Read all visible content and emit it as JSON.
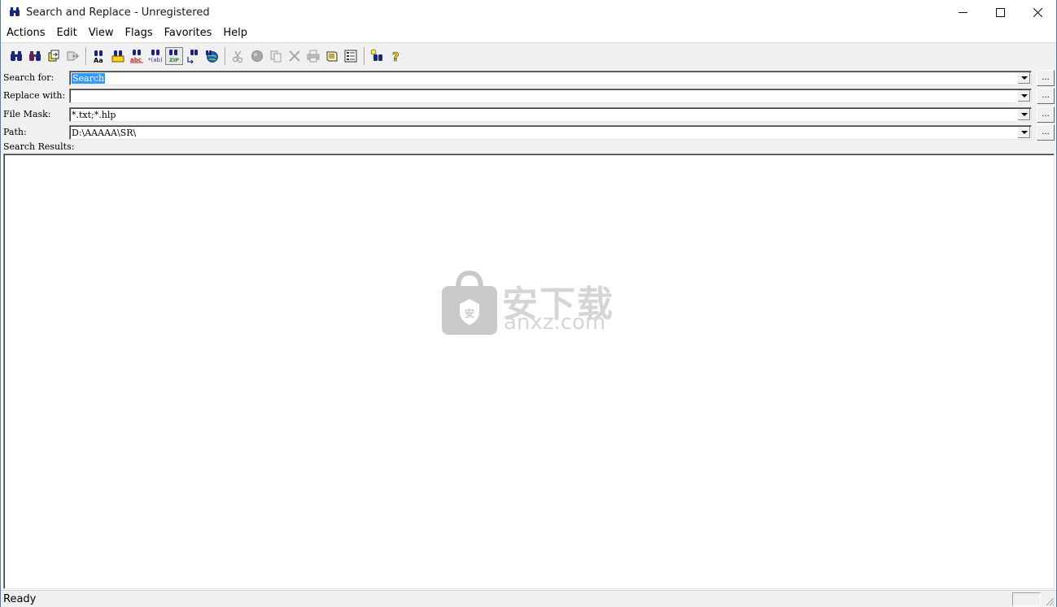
{
  "window": {
    "title": "Search and Replace - Unregistered",
    "controls": {
      "minimize": "—",
      "maximize": "☐",
      "close": "✕"
    }
  },
  "menu": {
    "items": [
      "Actions",
      "Edit",
      "View",
      "Flags",
      "Favorites",
      "Help"
    ]
  },
  "toolbar": {
    "groups": [
      [
        "search-icon",
        "search-replace-icon",
        "copy-files-icon",
        "move-files-icon"
      ],
      [
        "case-sensitive-icon",
        "whole-word-icon",
        "abc-icon",
        "regex-icon",
        "zip-search-icon",
        "subfolder-icon",
        "web-search-icon"
      ],
      [
        "scissors-icon",
        "stop-icon",
        "copy-icon",
        "delete-icon",
        "print-icon",
        "open-script-icon",
        "options-icon"
      ],
      [
        "find-tip-icon",
        "help-icon"
      ]
    ]
  },
  "form": {
    "search_label": "Search for:",
    "search_value": "Search",
    "replace_label": "Replace with:",
    "replace_value": "",
    "mask_label": "File Mask:",
    "mask_value": "*.txt;*.hlp",
    "path_label": "Path:",
    "path_value": "D:\\AAAAA\\SR\\",
    "browse_label": "...",
    "results_label": "Search Results:"
  },
  "status": {
    "text": "Ready"
  },
  "watermark": {
    "cn": "安下载",
    "en": "anxz.com"
  },
  "colors": {
    "selection": "#3399ff",
    "chrome": "#f0f0f0",
    "icon_primary": "#1a237e"
  }
}
